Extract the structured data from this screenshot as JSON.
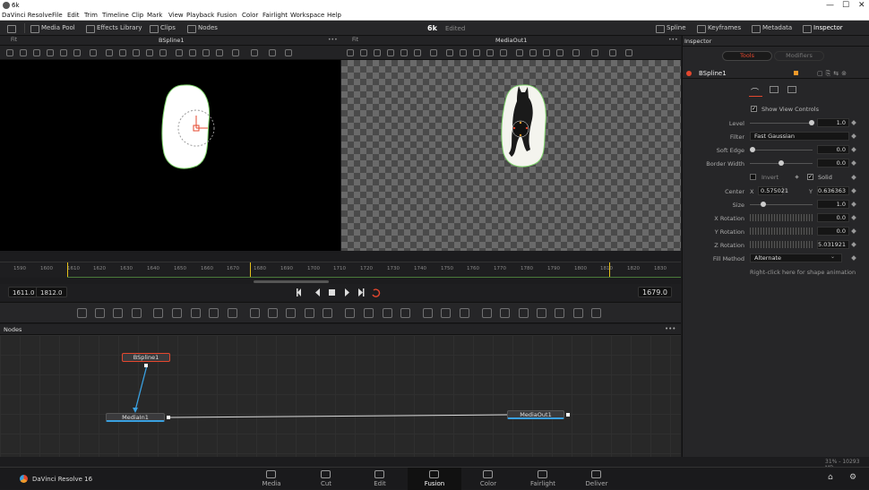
{
  "window": {
    "title": "6k",
    "min": "—",
    "max": "☐",
    "close": "✕"
  },
  "menu": [
    "DaVinci Resolve",
    "File",
    "Edit",
    "Trim",
    "Timeline",
    "Clip",
    "Mark",
    "View",
    "Playback",
    "Fusion",
    "Color",
    "Fairlight",
    "Workspace",
    "Help"
  ],
  "toolbar": {
    "media_pool": "Media Pool",
    "effects_library": "Effects Library",
    "clips": "Clips",
    "nodes": "Nodes",
    "project": "6k",
    "status": "Edited",
    "spline": "Spline",
    "keyframes": "Keyframes",
    "metadata": "Metadata",
    "inspector": "Inspector"
  },
  "viewer_left": {
    "fit": "Fit",
    "name": "BSpline1",
    "more": "•••"
  },
  "viewer_right": {
    "fit": "Fit",
    "name": "MediaOut1",
    "more": "•••"
  },
  "ruler": [
    "1590",
    "1600",
    "1610",
    "1620",
    "1630",
    "1640",
    "1650",
    "1660",
    "1670",
    "1680",
    "1690",
    "1700",
    "1710",
    "1720",
    "1730",
    "1740",
    "1750",
    "1760",
    "1770",
    "1780",
    "1790",
    "1800",
    "1810",
    "1820",
    "1830"
  ],
  "transport": {
    "in": "1611.0",
    "out": "1812.0",
    "current": "1679.0"
  },
  "nodes_panel": {
    "title": "Nodes",
    "more": "•••",
    "nodes": {
      "bspline": "BSpline1",
      "mediain": "MediaIn1",
      "mediaout": "MediaOut1"
    }
  },
  "inspector": {
    "tab_tools": "Tools",
    "tab_modifiers": "Modifiers",
    "node_name": "BSpline1",
    "show_view_controls": "Show View Controls",
    "level": {
      "label": "Level",
      "value": "1.0"
    },
    "filter": {
      "label": "Filter",
      "value": "Fast Gaussian"
    },
    "soft_edge": {
      "label": "Soft Edge",
      "value": "0.0"
    },
    "border_width": {
      "label": "Border Width",
      "value": "0.0"
    },
    "invert": "Invert",
    "solid": "Solid",
    "center": {
      "label": "Center",
      "x_label": "X",
      "x": "0.575021",
      "y_label": "Y",
      "y": "0.636363"
    },
    "size": {
      "label": "Size",
      "value": "1.0"
    },
    "x_rotation": {
      "label": "X Rotation",
      "value": "0.0"
    },
    "y_rotation": {
      "label": "Y Rotation",
      "value": "0.0"
    },
    "z_rotation": {
      "label": "Z Rotation",
      "value": "5.031921"
    },
    "fill_method": {
      "label": "Fill Method",
      "value": "Alternate"
    },
    "hint": "Right-click here for shape animation"
  },
  "status": {
    "memory": "31% - 10293 MB"
  },
  "app_name": "DaVinci Resolve 16",
  "pages": [
    "Media",
    "Cut",
    "Edit",
    "Fusion",
    "Color",
    "Fairlight",
    "Deliver"
  ],
  "colors": {
    "accent_red": "#e4472e",
    "selection_orange": "#f09a2b",
    "playhead": "#e6c11a"
  }
}
